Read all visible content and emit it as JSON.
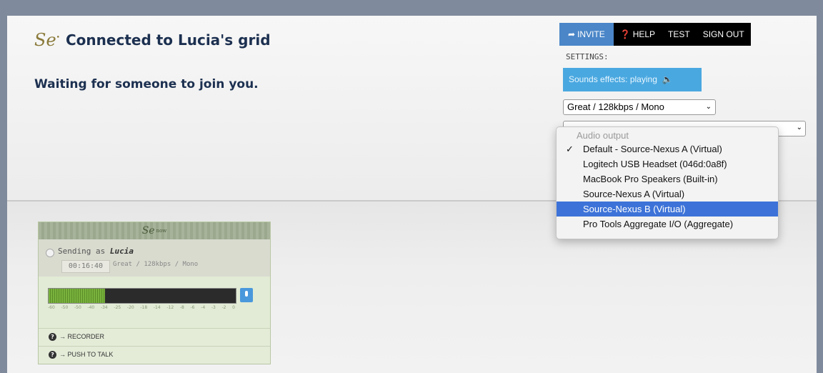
{
  "header": {
    "logo": "Se",
    "title": "Connected to Lucia's grid",
    "subtitle": "Waiting for someone to join you."
  },
  "nav": {
    "invite": "INVITE",
    "help": "HELP",
    "test": "TEST",
    "sign_out": "SIGN OUT"
  },
  "settings": {
    "label": "SETTINGS:",
    "sound_effects": "Sounds effects: playing",
    "quality_selected": "Great / 128kbps / Mono"
  },
  "audio_output": {
    "header": "Audio output",
    "items": [
      {
        "label": "Default - Source-Nexus A (Virtual)",
        "checked": true,
        "highlighted": false
      },
      {
        "label": "Logitech USB Headset (046d:0a8f)",
        "checked": false,
        "highlighted": false
      },
      {
        "label": "MacBook Pro Speakers (Built-in)",
        "checked": false,
        "highlighted": false
      },
      {
        "label": "Source-Nexus A (Virtual)",
        "checked": false,
        "highlighted": false
      },
      {
        "label": "Source-Nexus B (Virtual)",
        "checked": false,
        "highlighted": true
      },
      {
        "label": "Pro Tools Aggregate I/O (Aggregate)",
        "checked": false,
        "highlighted": false
      }
    ],
    "check_mark": "✓"
  },
  "widget": {
    "logo": "Se",
    "logo_tag": "now",
    "sending_prefix": "Sending as",
    "sender": "Lucia",
    "timer": "00:16:40",
    "stream": "Great / 128kbps / Mono",
    "meter_level": 0.3,
    "scale": [
      "-60",
      "-50",
      "-50",
      "-40",
      "-34",
      "-25",
      "-20",
      "-18",
      "-14",
      "-12",
      "-8",
      "-6",
      "-4",
      "-3",
      "-2",
      "0"
    ],
    "recorder": "→ RECORDER",
    "push_to_talk": "→ PUSH TO TALK"
  },
  "colors": {
    "accent": "#4a86c8",
    "sfx": "#4aa8e0",
    "title": "#1c3050",
    "highlight": "#3d73d8"
  }
}
